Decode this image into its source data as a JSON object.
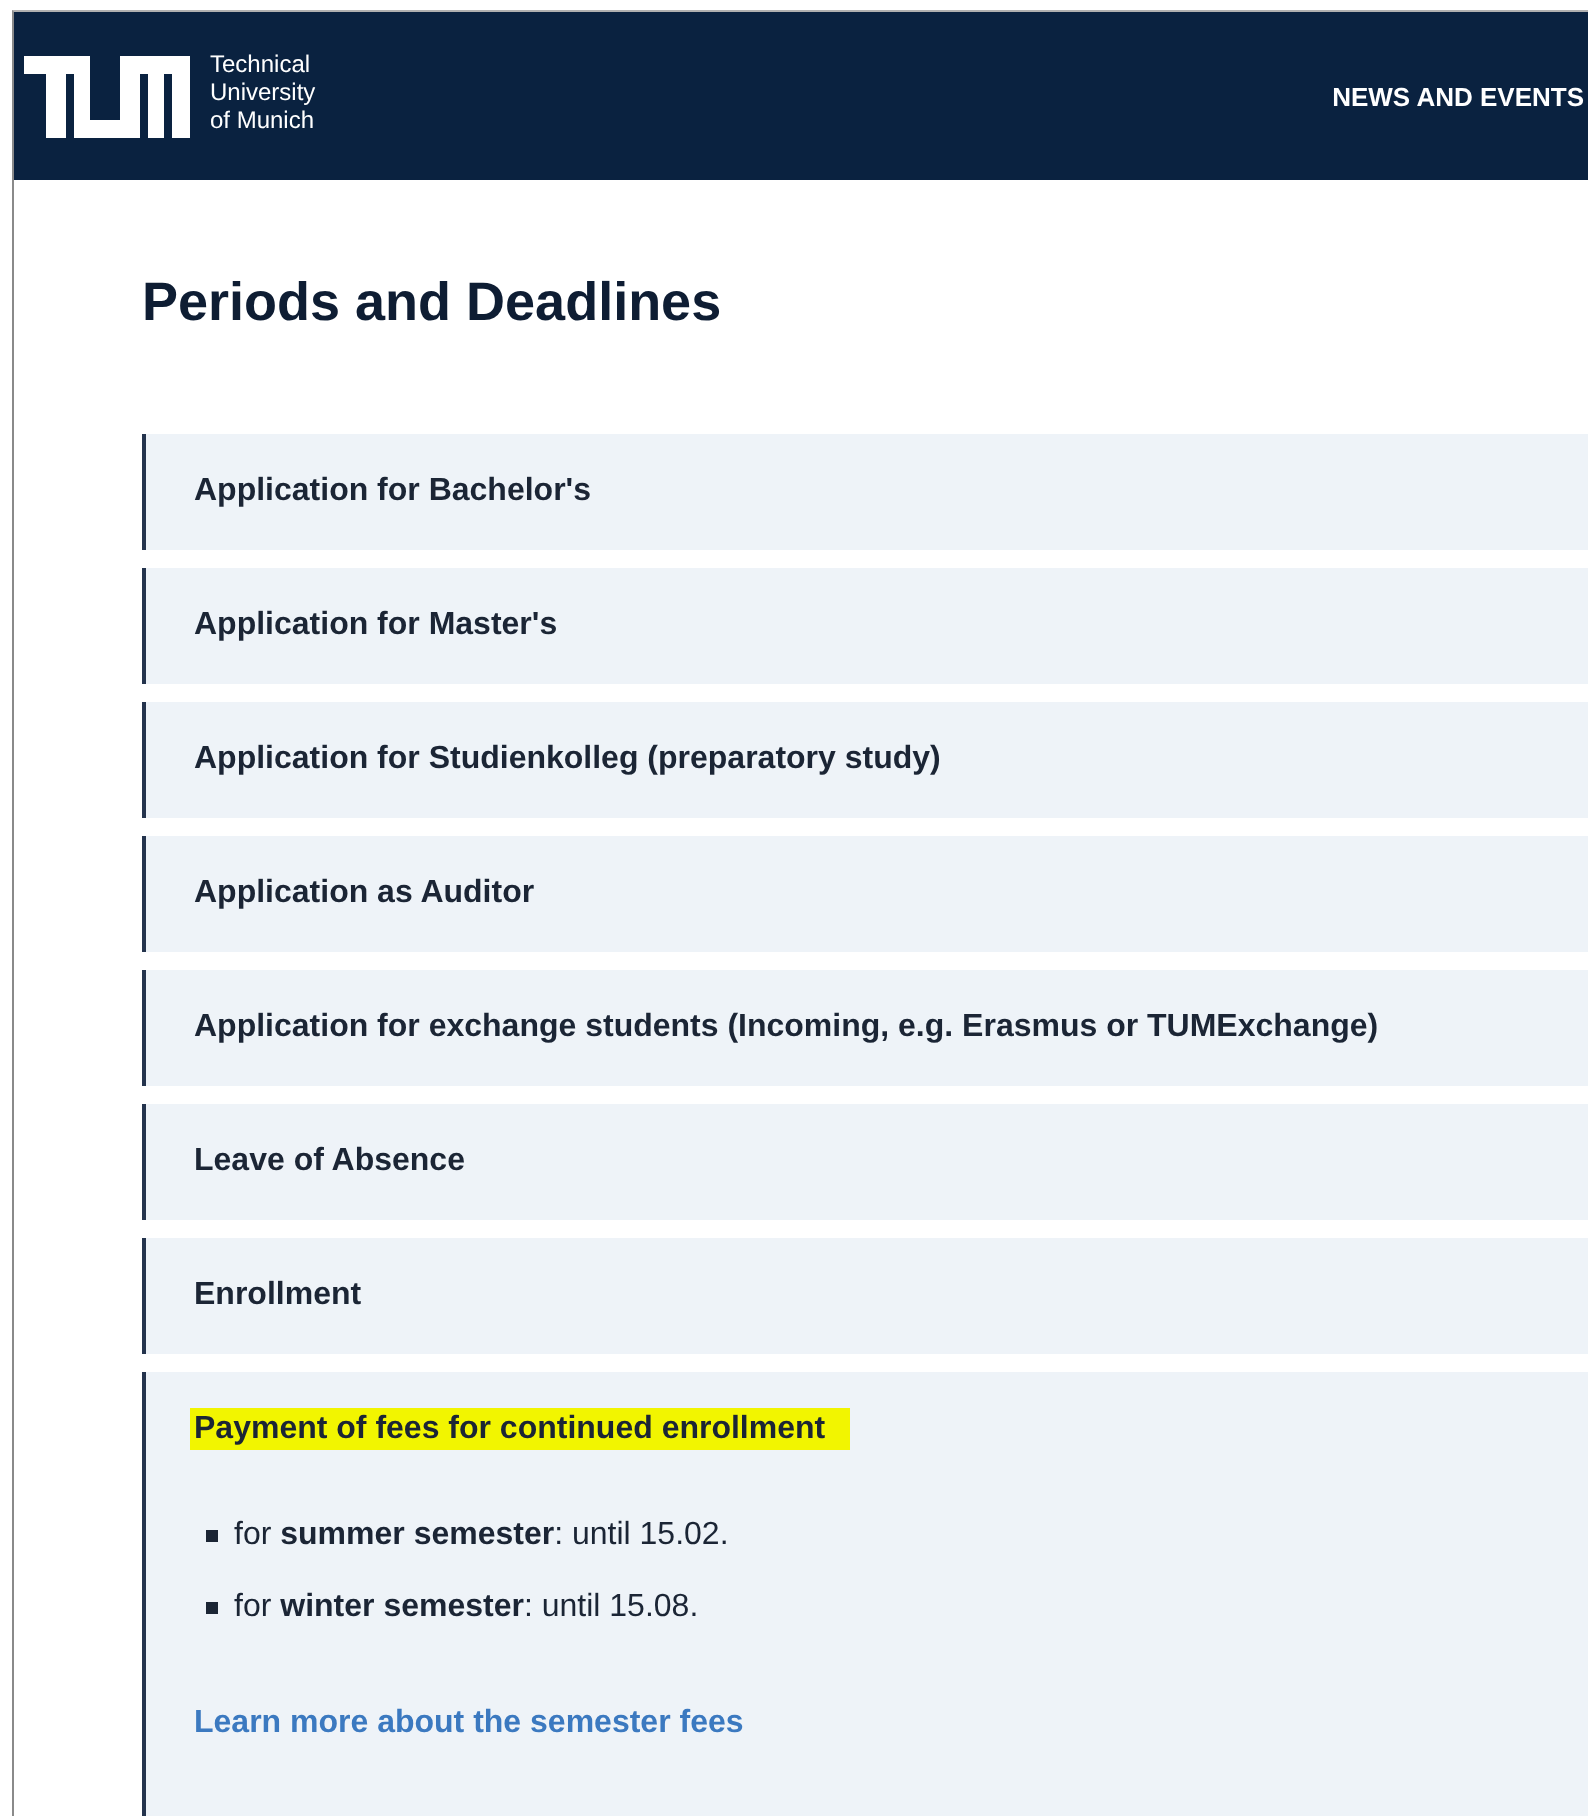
{
  "header": {
    "logo_text": [
      "Technical",
      "University",
      "of Munich"
    ],
    "nav_link": "NEWS AND EVENTS"
  },
  "title": "Periods and Deadlines",
  "sections": [
    {
      "label": "Application for Bachelor's",
      "expanded": false,
      "highlighted": false
    },
    {
      "label": "Application for Master's",
      "expanded": false,
      "highlighted": false
    },
    {
      "label": "Application for Studienkolleg (preparatory study)",
      "expanded": false,
      "highlighted": false
    },
    {
      "label": "Application as Auditor",
      "expanded": false,
      "highlighted": false
    },
    {
      "label": "Application for exchange students (Incoming, e.g. Erasmus or TUMExchange)",
      "expanded": false,
      "highlighted": false
    },
    {
      "label": "Leave of Absence",
      "expanded": false,
      "highlighted": false
    },
    {
      "label": "Enrollment",
      "expanded": false,
      "highlighted": false
    },
    {
      "label": "Payment of fees for continued enrollment",
      "expanded": true,
      "highlighted": true,
      "items": [
        "for **summer semester**: until 15.02.",
        "for **winter semester**: until 15.08."
      ],
      "link": "Learn more about the semester fees"
    }
  ]
}
